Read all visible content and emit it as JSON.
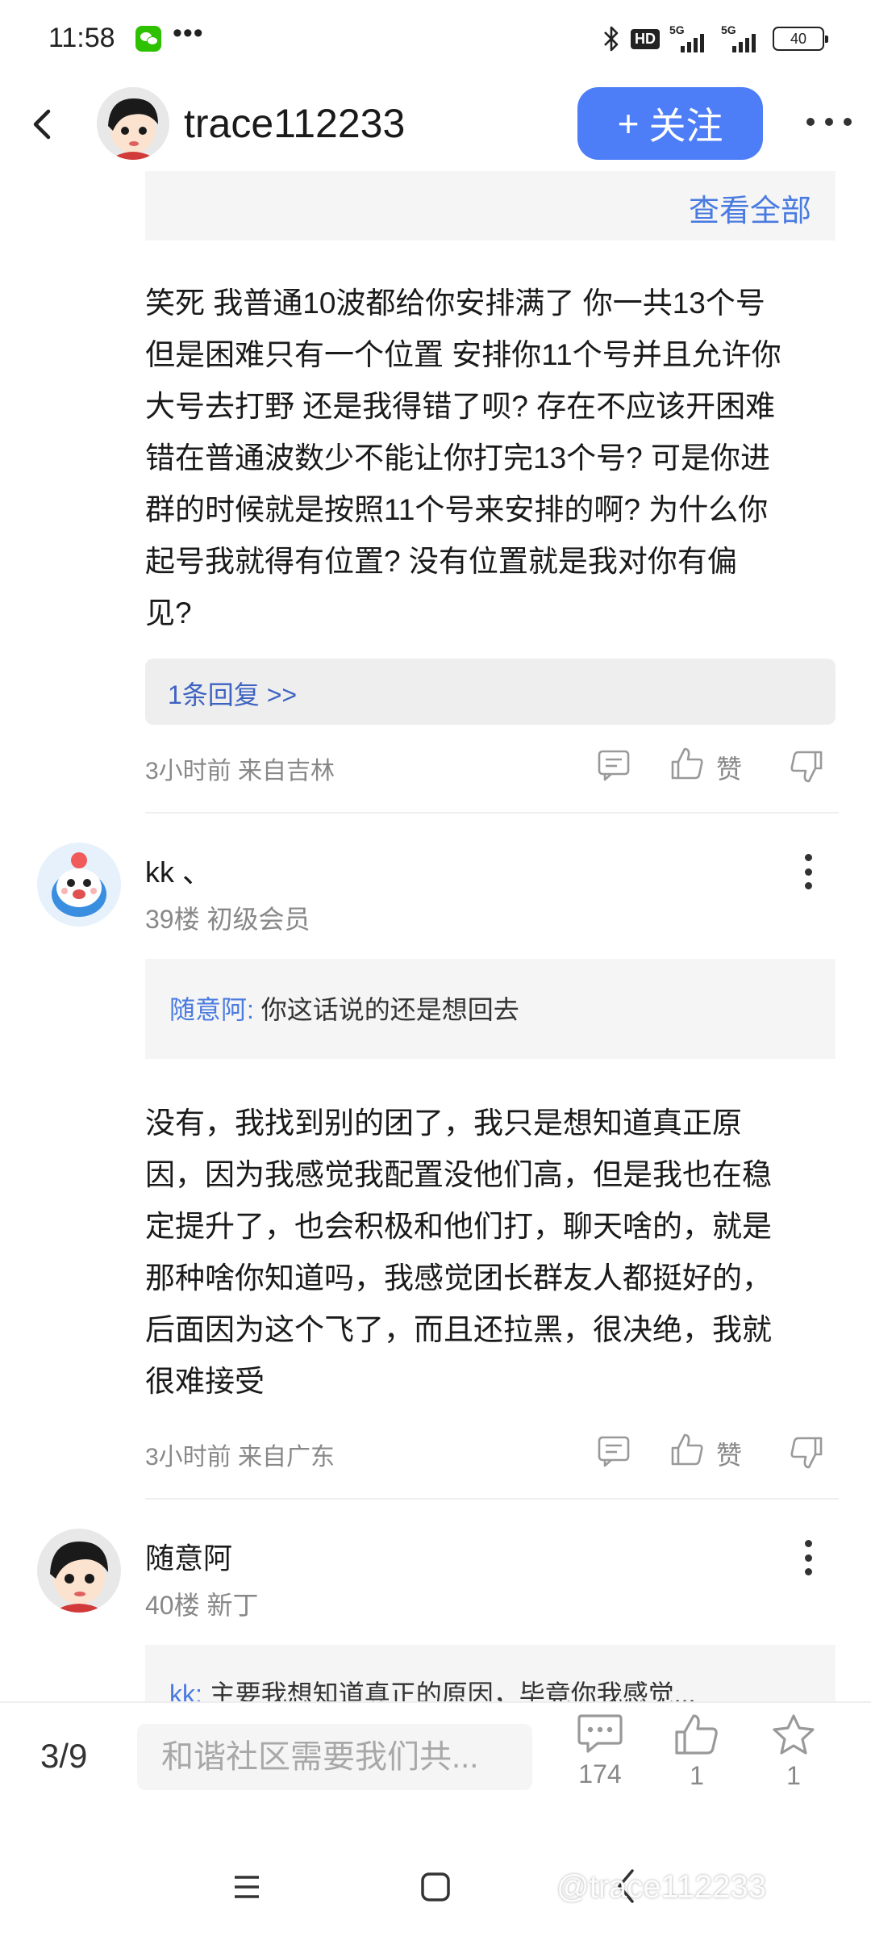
{
  "status_bar": {
    "time": "11:58",
    "dots": "•••",
    "hd": "HD",
    "net1": "5G",
    "net2": "5G",
    "battery": "40"
  },
  "header": {
    "username": "trace112233",
    "follow_label": "关注",
    "follow_plus": "+"
  },
  "quoted_top": {
    "view_all": "查看全部"
  },
  "comment_1": {
    "lines": [
      "笑死  我普通10波都给你安排满了  你一共13个号",
      "但是困难只有一个位置 安排你11个号并且允许你",
      "大号去打野 还是我得错了呗? 存在不应该开困难",
      "错在普通波数少不能让你打完13个号? 可是你进",
      "群的时候就是按照11个号来安排的啊? 为什么你",
      "起号我就得有位置? 没有位置就是我对你有偏",
      "见?"
    ],
    "replies_link": "1条回复 >>",
    "meta": "3小时前 来自吉林",
    "like_label": "赞"
  },
  "comment_2": {
    "username": "kk 、",
    "floor": "39楼 初级会员",
    "quote_name": "随意阿:",
    "quote_text": "你这话说的还是想回去",
    "lines": [
      "没有，我找到别的团了，我只是想知道真正原",
      "因，因为我感觉我配置没他们高，但是我也在稳",
      "定提升了，也会积极和他们打，聊天啥的，就是",
      "那种啥你知道吗，我感觉团长群友人都挺好的，",
      "后面因为这个飞了，而且还拉黑，很决绝，我就",
      "很难接受"
    ],
    "meta": "3小时前 来自广东",
    "like_label": "赞"
  },
  "comment_3": {
    "username": "随意阿",
    "floor": "40楼 新丁",
    "quote_name": "kk:",
    "quote_text": "主要我想知道真正的原因，毕竟你我感觉..."
  },
  "bottom_bar": {
    "page": "3/9",
    "input_placeholder": "和谐社区需要我们共...",
    "comments_count": "174",
    "likes_count": "1",
    "favorites_count": "1"
  },
  "watermark": "@trace112233",
  "colors": {
    "accent": "#4d7ef7",
    "link": "#4a7be0",
    "meta": "#888888"
  }
}
